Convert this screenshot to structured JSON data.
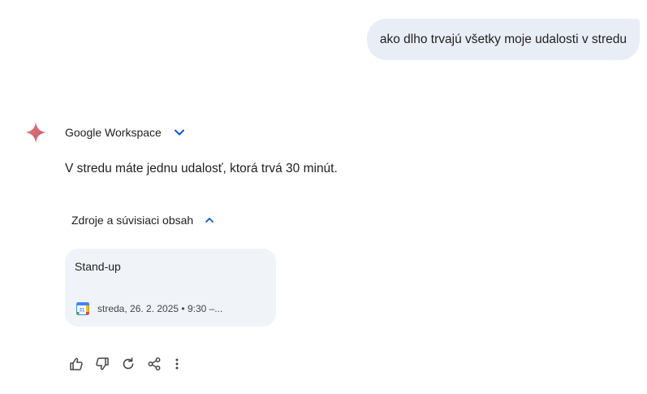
{
  "user_message": "ako dlho trvajú všetky moje udalosti v stredu",
  "response": {
    "source_label": "Google Workspace",
    "answer_text": "V stredu máte jednu udalosť, ktorá trvá 30 minút.",
    "sources_toggle_label": "Zdroje a súvisiaci obsah",
    "source_card": {
      "title": "Stand-up",
      "meta": "streda, 26. 2. 2025 • 9:30 –...",
      "calendar_icon_day": "31"
    }
  },
  "actions": [
    {
      "icon": "thumbs-up-icon"
    },
    {
      "icon": "thumbs-down-icon"
    },
    {
      "icon": "regenerate-icon"
    },
    {
      "icon": "share-icon"
    },
    {
      "icon": "more-vert-icon"
    }
  ],
  "colors": {
    "user_bubble_bg": "#e9eef6",
    "card_bg": "#f0f4f9",
    "accent_blue": "#0b57d0",
    "spark": "#d56d79"
  }
}
